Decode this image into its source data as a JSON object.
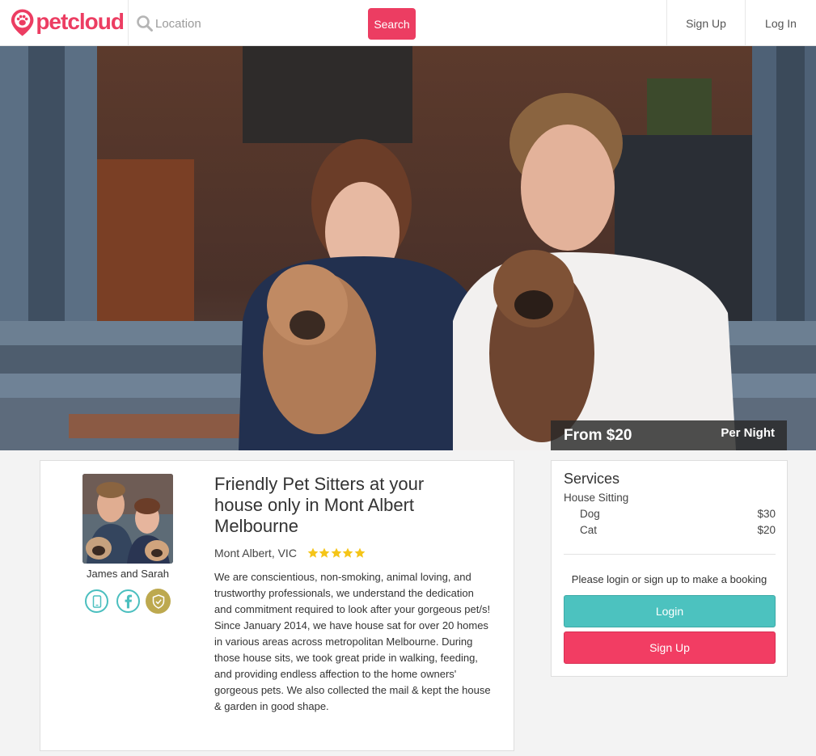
{
  "header": {
    "logo_text": "petcloud",
    "search": {
      "placeholder": "Location",
      "button_label": "Search"
    },
    "nav": {
      "signup_label": "Sign Up",
      "login_label": "Log In"
    }
  },
  "hero": {
    "price_from": "From $20",
    "price_per": "Per Night"
  },
  "profile": {
    "owner_name": "James and Sarah",
    "badges": [
      "phone-verified-icon",
      "facebook-icon",
      "shield-check-icon"
    ],
    "title": "Friendly Pet Sitters at your house only in Mont Albert Melbourne",
    "location": "Mont Albert, VIC",
    "rating_stars": 5,
    "description": "We are conscientious, non-smoking, animal loving, and trustworthy professionals, we understand the dedication and commitment required to look after your gorgeous pet/s! Since January 2014, we have house sat for over 20 homes in various areas across metropolitan Melbourne. During those house sits, we took great pride in walking, feeding, and providing endless affection to the home owners' gorgeous pets. We also collected the mail & kept the house & garden in good shape."
  },
  "services": {
    "title": "Services",
    "category": "House Sitting",
    "items": [
      {
        "name": "Dog",
        "price": "$30"
      },
      {
        "name": "Cat",
        "price": "$20"
      }
    ],
    "login_prompt": "Please login or sign up to make a booking",
    "login_button": "Login",
    "signup_button": "Sign Up"
  },
  "colors": {
    "brand": "#ec3d62",
    "teal": "#4cc2bf",
    "star": "#f5c518",
    "badge_gold": "#bda94f"
  }
}
